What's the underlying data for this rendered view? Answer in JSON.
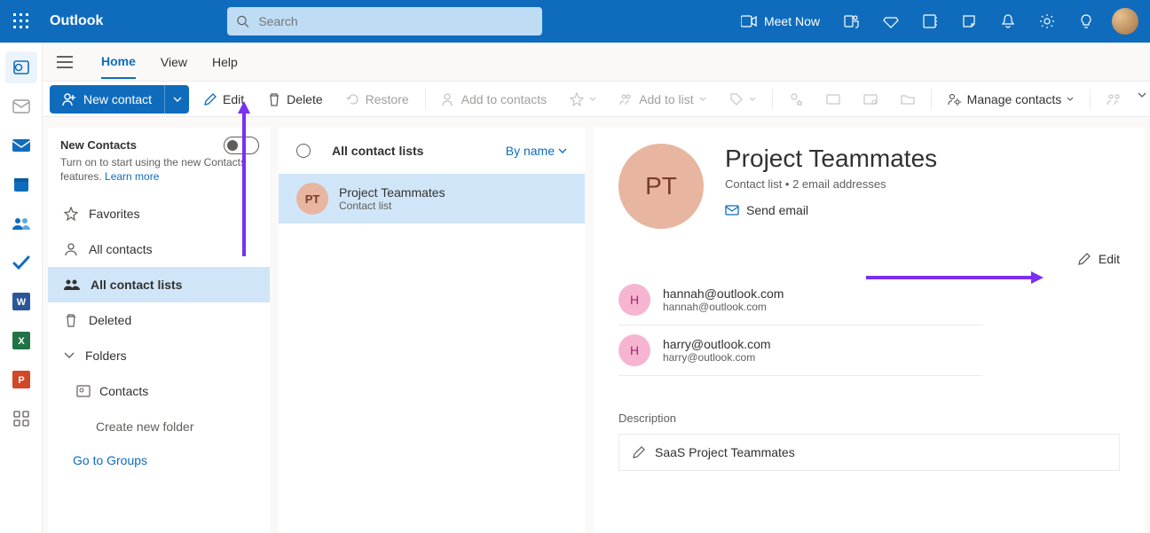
{
  "brand": "Outlook",
  "search": {
    "placeholder": "Search"
  },
  "top": {
    "meet": "Meet Now"
  },
  "tabs": {
    "home": "Home",
    "view": "View",
    "help": "Help"
  },
  "toolbar": {
    "newcontact": "New contact",
    "edit": "Edit",
    "delete": "Delete",
    "restore": "Restore",
    "addcontacts": "Add to contacts",
    "addlist": "Add to list",
    "manage": "Manage contacts"
  },
  "nav": {
    "newcontacts_title": "New Contacts",
    "newcontacts_sub": "Turn on to start using the new Contacts features.  ",
    "learnmore": "Learn more",
    "favorites": "Favorites",
    "allcontacts": "All contacts",
    "allcontactlists": "All contact lists",
    "deleted": "Deleted",
    "folders": "Folders",
    "contactsfolder": "Contacts",
    "createfolder": "Create new folder",
    "gogroups": "Go to Groups"
  },
  "list": {
    "header": "All contact lists",
    "sort": "By name",
    "items": [
      {
        "initials": "PT",
        "title": "Project Teammates",
        "sub": "Contact list"
      }
    ]
  },
  "detail": {
    "initials": "PT",
    "title": "Project Teammates",
    "sub": "Contact list • 2 email addresses",
    "sendemail": "Send email",
    "edit": "Edit",
    "members": [
      {
        "initial": "H",
        "name": "hannah@outlook.com",
        "email": "hannah@outlook.com"
      },
      {
        "initial": "H",
        "name": "harry@outlook.com",
        "email": "harry@outlook.com"
      }
    ],
    "description_label": "Description",
    "description": "SaaS Project Teammates"
  }
}
